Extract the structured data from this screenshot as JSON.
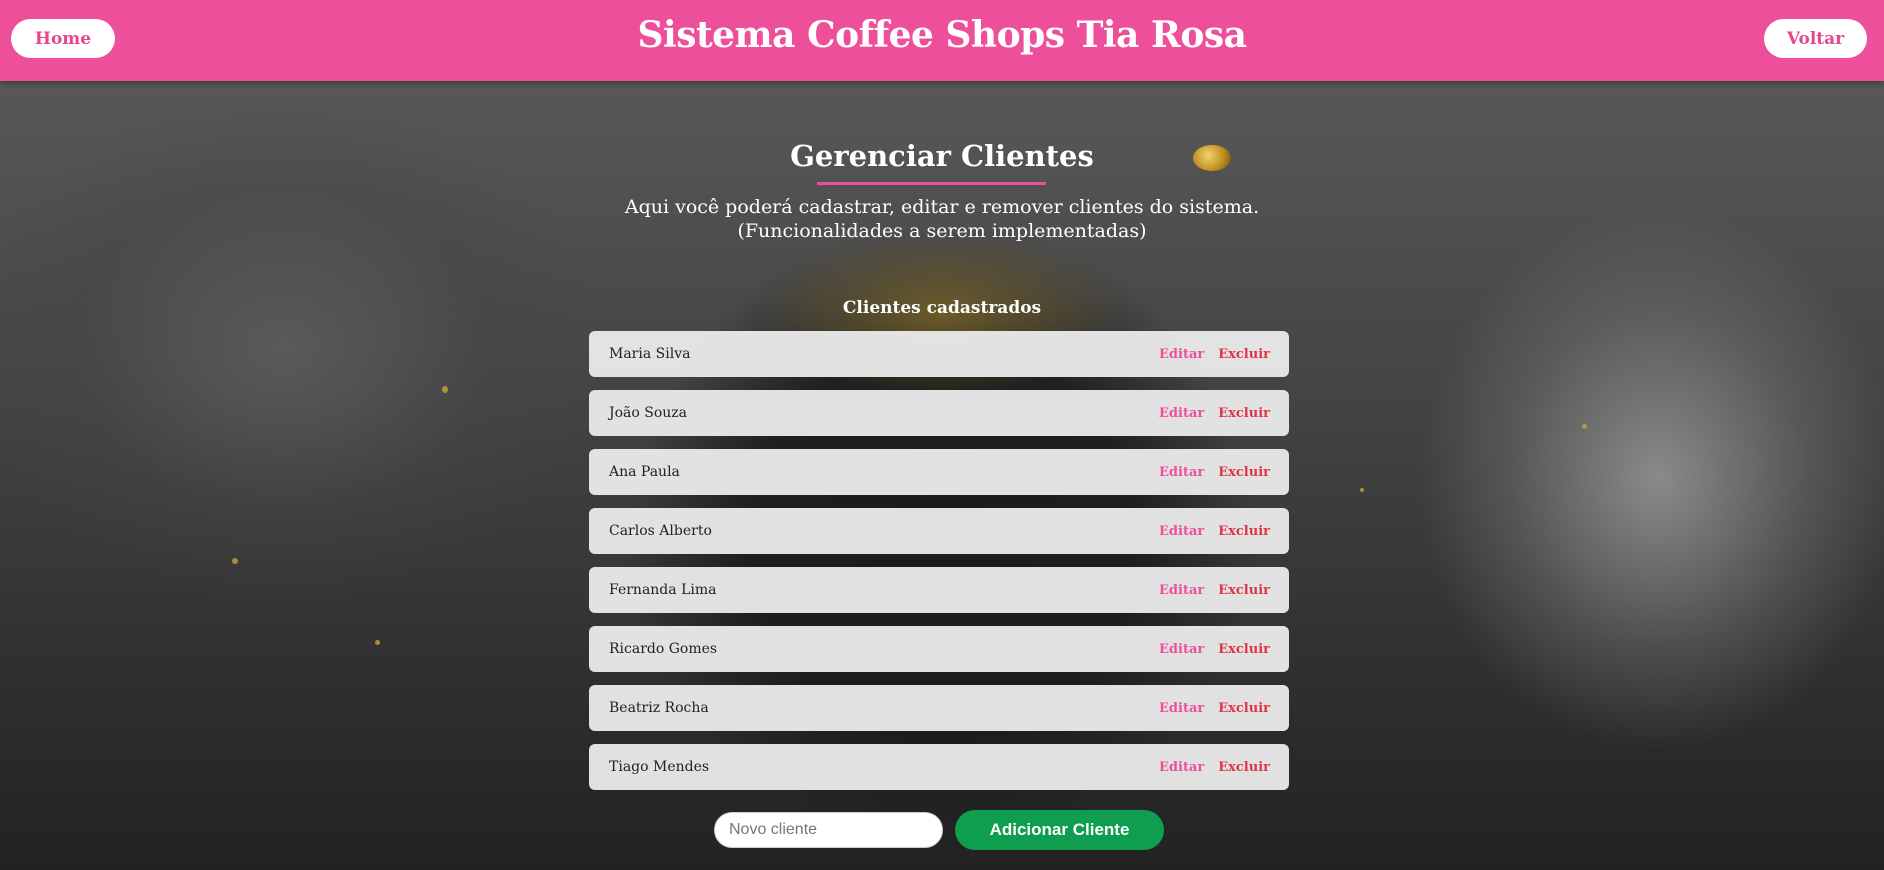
{
  "header": {
    "title": "Sistema Coffee Shops Tia Rosa",
    "home_label": "Home",
    "back_label": "Voltar"
  },
  "main": {
    "title": "Gerenciar Clientes",
    "subtitle_line1": "Aqui você poderá cadastrar, editar e remover clientes do sistema.",
    "subtitle_line2": "(Funcionalidades a serem implementadas)",
    "list_title": "Clientes cadastrados",
    "edit_label": "Editar",
    "delete_label": "Excluir",
    "clients": [
      "Maria Silva",
      "João Souza",
      "Ana Paula",
      "Carlos Alberto",
      "Fernanda Lima",
      "Ricardo Gomes",
      "Beatriz Rocha",
      "Tiago Mendes"
    ]
  },
  "form": {
    "placeholder": "Novo cliente",
    "add_label": "Adicionar Cliente"
  },
  "colors": {
    "accent": "#ee4f9a",
    "delete": "#e03548",
    "add_button": "#0f9d4f"
  },
  "icons": {
    "decorative": "coffee-beans-icon"
  }
}
